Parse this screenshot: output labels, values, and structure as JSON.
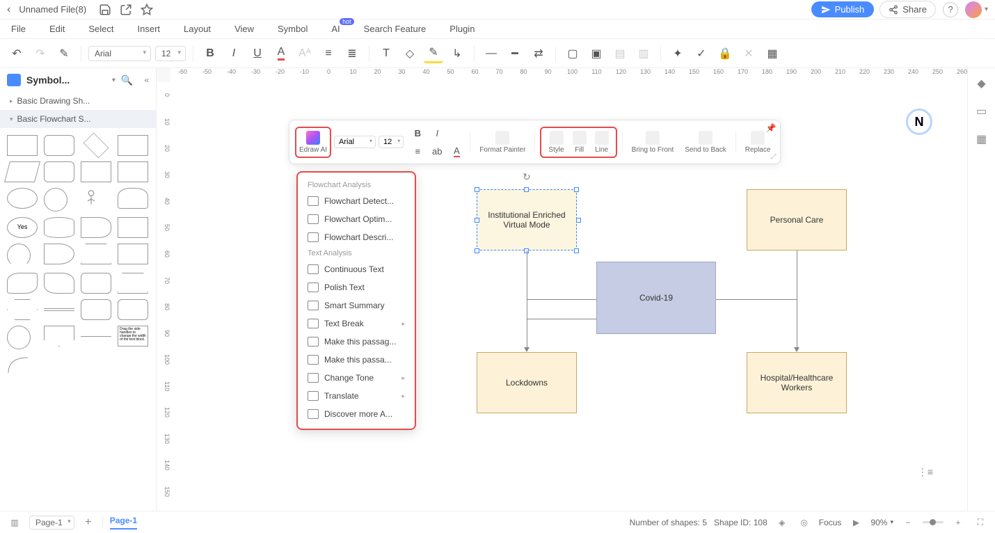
{
  "topbar": {
    "title": "Unnamed File(8)",
    "publish": "Publish",
    "share": "Share"
  },
  "menubar": {
    "file": "File",
    "edit": "Edit",
    "select": "Select",
    "insert": "Insert",
    "layout": "Layout",
    "view": "View",
    "symbol": "Symbol",
    "ai": "AI",
    "ai_badge": "hot",
    "search": "Search Feature",
    "plugin": "Plugin"
  },
  "toolbar": {
    "font": "Arial",
    "size": "12"
  },
  "sidebar": {
    "title": "Symbol...",
    "sections": {
      "basic_drawing": "Basic Drawing Sh...",
      "basic_flowchart": "Basic Flowchart S..."
    },
    "yes_label": "Yes"
  },
  "float": {
    "edraw": "Edraw AI",
    "font": "Arial",
    "size": "12",
    "format_painter": "Format Painter",
    "style": "Style",
    "fill": "Fill",
    "line": "Line",
    "bring_front": "Bring to Front",
    "send_back": "Send to Back",
    "replace": "Replace"
  },
  "ai_menu": {
    "flowchart_heading": "Flowchart Analysis",
    "detect": "Flowchart Detect...",
    "optim": "Flowchart Optim...",
    "descri": "Flowchart Descri...",
    "text_heading": "Text Analysis",
    "continuous": "Continuous Text",
    "polish": "Polish Text",
    "summary": "Smart Summary",
    "break": "Text Break",
    "passage1": "Make this passag...",
    "passage2": "Make this passa...",
    "tone": "Change Tone",
    "translate": "Translate",
    "discover": "Discover more A..."
  },
  "shapes": {
    "institutional": "Institutional Enriched Virtual Mode",
    "personal": "Personal Care",
    "covid": "Covid-19",
    "lockdowns": "Lockdowns",
    "hospital": "Hospital/Healthcare Workers"
  },
  "ruler_h": [
    "-60",
    "-50",
    "-40",
    "-30",
    "-20",
    "-10",
    "0",
    "10",
    "20",
    "30",
    "40",
    "50",
    "60",
    "70",
    "80",
    "90",
    "100",
    "110",
    "120",
    "130",
    "140",
    "150",
    "160",
    "170",
    "180",
    "190",
    "200",
    "210",
    "220",
    "230",
    "240",
    "250",
    "260"
  ],
  "ruler_v": [
    "0",
    "10",
    "20",
    "30",
    "40",
    "50",
    "60",
    "70",
    "80",
    "90",
    "100",
    "110",
    "120",
    "130",
    "140",
    "150"
  ],
  "status": {
    "page_sel": "Page-1",
    "tab": "Page-1",
    "shapes_count": "Number of shapes: 5",
    "shape_id": "Shape ID: 108",
    "focus": "Focus",
    "zoom": "90%"
  }
}
